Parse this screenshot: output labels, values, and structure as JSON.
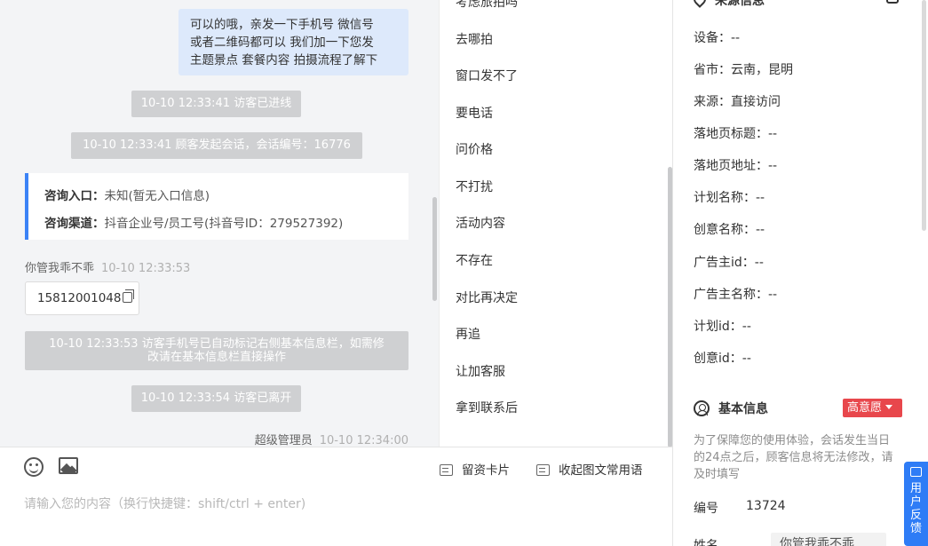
{
  "chat": {
    "outgoing_lines": [
      "可以的哦，亲发一下手机号 微信号",
      "或者二维码都可以 我们加一下您发",
      "主题景点 套餐内容 拍摄流程了解下"
    ],
    "sys_enter": "10-10 12:33:41 访客已进线",
    "sys_session": "10-10 12:33:41 顾客发起会话，会话编号：16776",
    "consult_entry_label": "咨询入口：",
    "consult_entry_value": "未知(暂无入口信息)",
    "consult_channel_label": "咨询渠道：",
    "consult_channel_value": "抖音企业号/员工号(抖音号ID：279527392)",
    "visitor_name": "你管我乖不乖",
    "visitor_time": "10-10 12:33:53",
    "phone_number": "15812001048",
    "sys_autotag_lines": [
      "10-10 12:33:53 访客手机号已自动标记右侧基本信息栏，如需修",
      "改请在基本信息栏直接操作"
    ],
    "sys_leave": "10-10 12:33:54 访客已离开",
    "admin_name": "超级管理员",
    "admin_time": "10-10 12:34:00"
  },
  "composer": {
    "emoji_icon": "emoji-icon",
    "image_icon": "image-icon",
    "leave_card": "留资卡片",
    "collapse_common": "收起图文常用语",
    "placeholder": "请输入您的内容（换行快捷键：shift/ctrl + enter)"
  },
  "quick_replies": [
    "考虑旅拍吗",
    "去哪拍",
    "窗口发不了",
    "要电话",
    "问价格",
    "不打扰",
    "活动内容",
    "不存在",
    "对比再决定",
    "再追",
    "让加客服",
    "拿到联系后"
  ],
  "source": {
    "title": "来源信息",
    "rows": [
      "设备：--",
      "省市：云南，昆明",
      "来源：直接访问",
      "落地页标题：--",
      "落地页地址：--",
      "计划名称：--",
      "创意名称：--",
      "广告主id：--",
      "广告主名称：--",
      "计划id：--",
      "创意id：--"
    ]
  },
  "basic": {
    "title": "基本信息",
    "intent_badge": "高意愿",
    "notice_lines": [
      "为了保障您的使用体验，会话发生当日",
      "的24点之后，顾客信息将无法修改，请",
      "及时填写"
    ],
    "id_label": "编号",
    "id_value": "13724",
    "name_label": "姓名",
    "name_value": "你管我乖不乖"
  },
  "feedback": {
    "chars": [
      "用",
      "户",
      "反",
      "馈"
    ]
  },
  "colors": {
    "accent": "#3b82f6",
    "bubble": "#dde9fb",
    "system": "#cfd0d2",
    "intent": "#e8474c",
    "feedback": "#2e7cf6"
  }
}
